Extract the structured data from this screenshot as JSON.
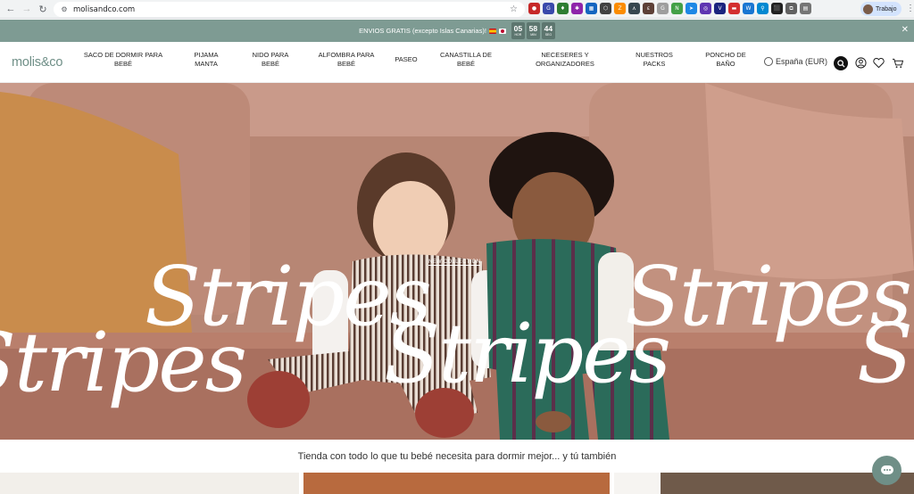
{
  "browser": {
    "url": "molisandco.com",
    "profile_label": "Trabajo",
    "extensions": [
      {
        "name": "ext-1",
        "color": "#c62828",
        "glyph": "●"
      },
      {
        "name": "ext-2",
        "color": "#3949ab",
        "glyph": "G"
      },
      {
        "name": "ext-3",
        "color": "#2e7d32",
        "glyph": "♦"
      },
      {
        "name": "ext-4",
        "color": "#8e24aa",
        "glyph": "✱"
      },
      {
        "name": "ext-5",
        "color": "#1565c0",
        "glyph": "▦"
      },
      {
        "name": "ext-6",
        "color": "#424242",
        "glyph": "⬡"
      },
      {
        "name": "ext-7",
        "color": "#fb8c00",
        "glyph": "Z"
      },
      {
        "name": "ext-8",
        "color": "#37474f",
        "glyph": "⋏"
      },
      {
        "name": "ext-9",
        "color": "#5d4037",
        "glyph": "ε"
      },
      {
        "name": "ext-10",
        "color": "#9e9e9e",
        "glyph": "G"
      },
      {
        "name": "ext-11",
        "color": "#43a047",
        "glyph": "N"
      },
      {
        "name": "ext-12",
        "color": "#1e88e5",
        "glyph": "➤"
      },
      {
        "name": "ext-13",
        "color": "#5e35b1",
        "glyph": "◎"
      },
      {
        "name": "ext-14",
        "color": "#1a237e",
        "glyph": "V"
      },
      {
        "name": "ext-15",
        "color": "#d32f2f",
        "glyph": "▬"
      },
      {
        "name": "ext-16",
        "color": "#1976d2",
        "glyph": "W"
      },
      {
        "name": "ext-17",
        "color": "#0288d1",
        "glyph": "⚲"
      },
      {
        "name": "ext-18",
        "color": "#212121",
        "glyph": "⬛"
      },
      {
        "name": "ext-19",
        "color": "#616161",
        "glyph": "⧉"
      },
      {
        "name": "ext-20",
        "color": "#757575",
        "glyph": "▤"
      }
    ]
  },
  "announcement": {
    "text": "ENVIOS GRATIS (excepto Islas Canarias)!",
    "timer": [
      {
        "value": "05",
        "unit": "HOR"
      },
      {
        "value": "58",
        "unit": "MIN"
      },
      {
        "value": "44",
        "unit": "SEG"
      }
    ]
  },
  "header": {
    "logo": "molis&co",
    "nav": [
      {
        "line1": "SACO DE DORMIR PARA",
        "line2": "BEBÉ"
      },
      {
        "line1": "PIJAMA",
        "line2": "MANTA"
      },
      {
        "line1": "NIDO PARA",
        "line2": "BEBÉ"
      },
      {
        "line1": "ALFOMBRA PARA",
        "line2": "BEBÉ"
      },
      {
        "line1": "PASEO",
        "line2": ""
      },
      {
        "line1": "CANASTILLA DE",
        "line2": "BEBÉ"
      },
      {
        "line1": "NECESERES Y",
        "line2": "ORGANIZADORES"
      },
      {
        "line1": "NUESTROS",
        "line2": "PACKS"
      },
      {
        "line1": "PONCHO DE",
        "line2": "BAÑO"
      }
    ],
    "locale": "España (EUR)"
  },
  "hero": {
    "tag": "NEW COLLECTION",
    "title_word": "Stripes"
  },
  "tagline": "Tienda con todo lo que tu bebé necesita para dormir mejor... y tú también",
  "colors": {
    "brand_green": "#6f8f87",
    "announce_bg": "#7e9b93",
    "sofa": "#b98a78"
  }
}
